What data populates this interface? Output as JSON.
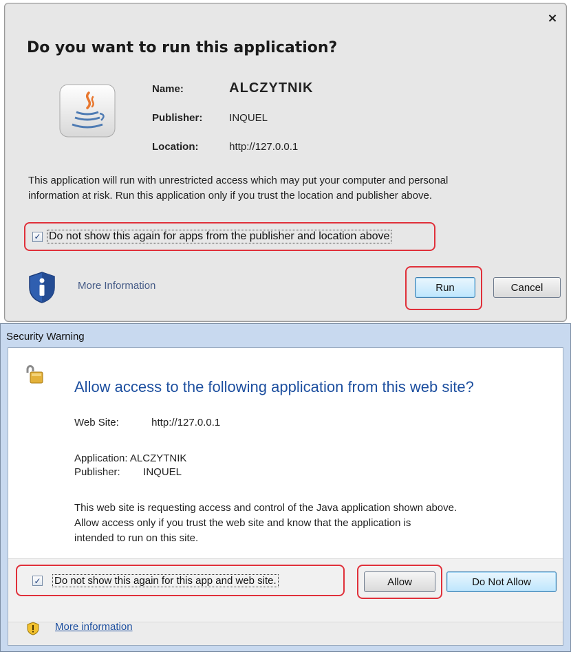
{
  "java_dialog": {
    "heading": "Do you want to run this application?",
    "close_glyph": "×",
    "icon": "java-cup-icon",
    "name_label": "Name:",
    "name_value": "ALCZYTNIK",
    "publisher_label": "Publisher:",
    "publisher_value": "INQUEL",
    "location_label": "Location:",
    "location_value": "http://127.0.0.1",
    "warning_line1": "This application will run with unrestricted access which may put your computer and personal",
    "warning_line2": "information at risk. Run this application only if you trust the location and publisher above.",
    "checkbox_checked": true,
    "checkbox_label": "Do not show this again for apps from the publisher and location above",
    "more_info_icon": "shield-info-icon",
    "more_info_label": "More Information",
    "run_label": "Run",
    "cancel_label": "Cancel"
  },
  "security_dialog": {
    "title": "Security Warning",
    "lock_icon": "lock-icon",
    "heading": "Allow access to the following application from this web site?",
    "website_label": "Web Site:",
    "website_value": "http://127.0.0.1",
    "application_label": "Application:",
    "application_value": "ALCZYTNIK",
    "publisher_label": "Publisher:",
    "publisher_value": "INQUEL",
    "body_line1": "This web site is requesting access and control of the Java application shown above.",
    "body_line2": "Allow access only if you trust the web site and know that the application is",
    "body_line3": "intended to run on this site.",
    "checkbox_checked": true,
    "checkbox_label": "Do not show this again for this app and web site.",
    "allow_label": "Allow",
    "deny_label": "Do Not Allow",
    "warn_icon": "warning-shield-icon",
    "more_info_label": "More information"
  },
  "colors": {
    "highlight": "#e0303a",
    "link": "#1d4f9f",
    "primary_button": "#bee6fd"
  }
}
